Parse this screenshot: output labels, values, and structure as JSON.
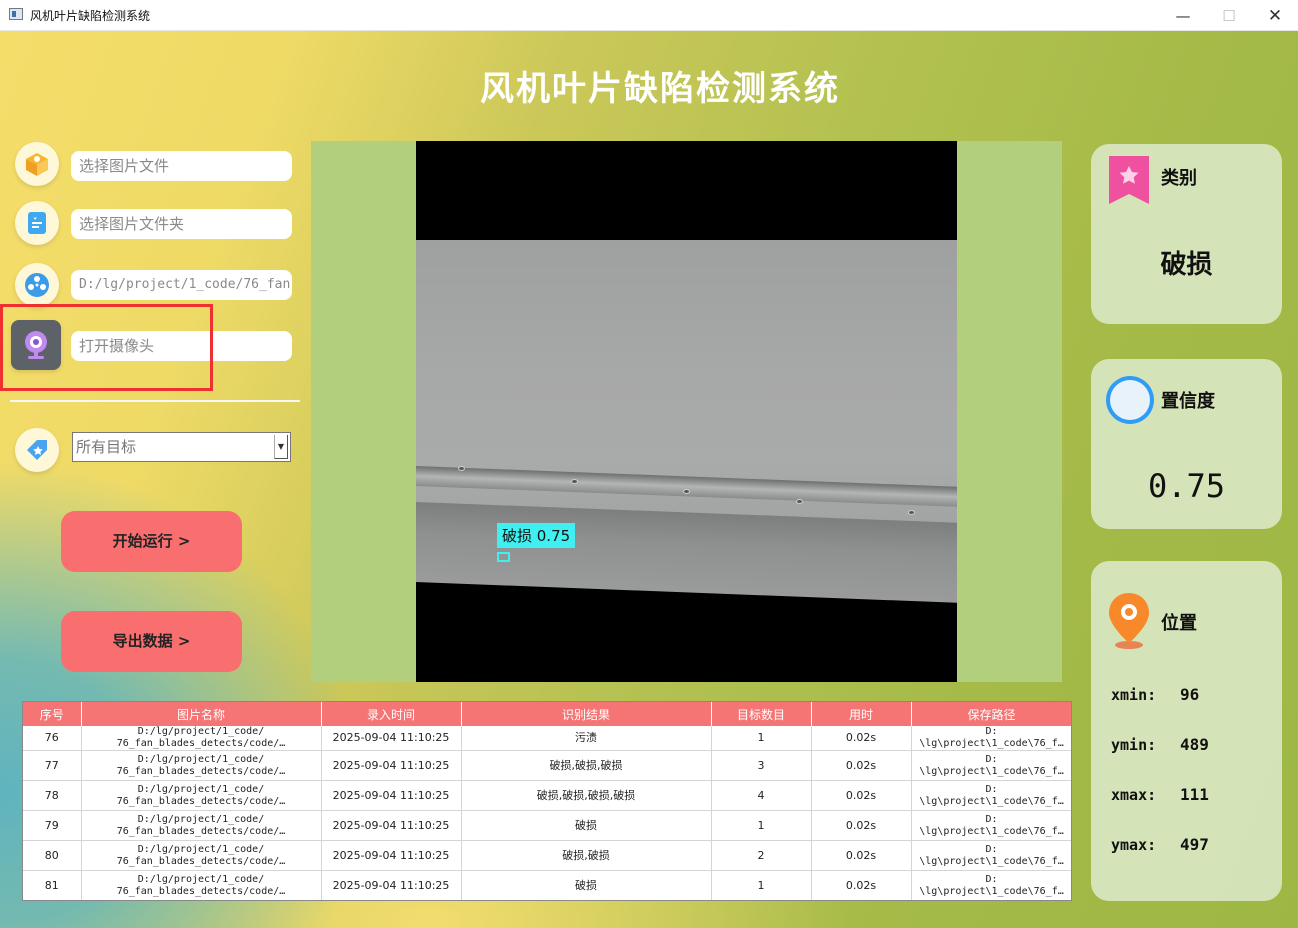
{
  "window": {
    "title": "风机叶片缺陷检测系统",
    "min": "—",
    "max": "☐",
    "close": "✕"
  },
  "app_title": "风机叶片缺陷检测系统",
  "left": {
    "select_image_placeholder": "选择图片文件",
    "select_folder_placeholder": "选择图片文件夹",
    "video_path": "D:/lg/project/1_code/76_fan",
    "camera_placeholder": "打开摄像头",
    "target_select": "所有目标",
    "start_button": "开始运行 >",
    "export_button": "导出数据 >"
  },
  "detection": {
    "label": "破损 0.75"
  },
  "info": {
    "category_title": "类别",
    "category_value": "破损",
    "confidence_title": "置信度",
    "confidence_value": "0.75",
    "position_title": "位置",
    "xmin_label": "xmin:",
    "xmin": "96",
    "ymin_label": "ymin:",
    "ymin": "489",
    "xmax_label": "xmax:",
    "xmax": "111",
    "ymax_label": "ymax:",
    "ymax": "497"
  },
  "table": {
    "headers": [
      "序号",
      "图片名称",
      "录入时间",
      "识别结果",
      "目标数目",
      "用时",
      "保存路径"
    ],
    "rows": [
      {
        "id": "76",
        "name1": "D:/lg/project/1_code/",
        "name2": "76_fan_blades_detects/code/…",
        "time": "2025-09-04 11:10:25",
        "result": "污渍",
        "count": "1",
        "elapsed": "0.02s",
        "path1": "D:",
        "path2": "\\lg\\project\\1_code\\76_f…"
      },
      {
        "id": "77",
        "name1": "D:/lg/project/1_code/",
        "name2": "76_fan_blades_detects/code/…",
        "time": "2025-09-04 11:10:25",
        "result": "破损,破损,破损",
        "count": "3",
        "elapsed": "0.02s",
        "path1": "D:",
        "path2": "\\lg\\project\\1_code\\76_f…"
      },
      {
        "id": "78",
        "name1": "D:/lg/project/1_code/",
        "name2": "76_fan_blades_detects/code/…",
        "time": "2025-09-04 11:10:25",
        "result": "破损,破损,破损,破损",
        "count": "4",
        "elapsed": "0.02s",
        "path1": "D:",
        "path2": "\\lg\\project\\1_code\\76_f…"
      },
      {
        "id": "79",
        "name1": "D:/lg/project/1_code/",
        "name2": "76_fan_blades_detects/code/…",
        "time": "2025-09-04 11:10:25",
        "result": "破损",
        "count": "1",
        "elapsed": "0.02s",
        "path1": "D:",
        "path2": "\\lg\\project\\1_code\\76_f…"
      },
      {
        "id": "80",
        "name1": "D:/lg/project/1_code/",
        "name2": "76_fan_blades_detects/code/…",
        "time": "2025-09-04 11:10:25",
        "result": "破损,破损",
        "count": "2",
        "elapsed": "0.02s",
        "path1": "D:",
        "path2": "\\lg\\project\\1_code\\76_f…"
      },
      {
        "id": "81",
        "name1": "D:/lg/project/1_code/",
        "name2": "76_fan_blades_detects/code/…",
        "time": "2025-09-04 11:10:25",
        "result": "破损",
        "count": "1",
        "elapsed": "0.02s",
        "path1": "D:",
        "path2": "\\lg\\project\\1_code\\76_f…"
      }
    ]
  }
}
